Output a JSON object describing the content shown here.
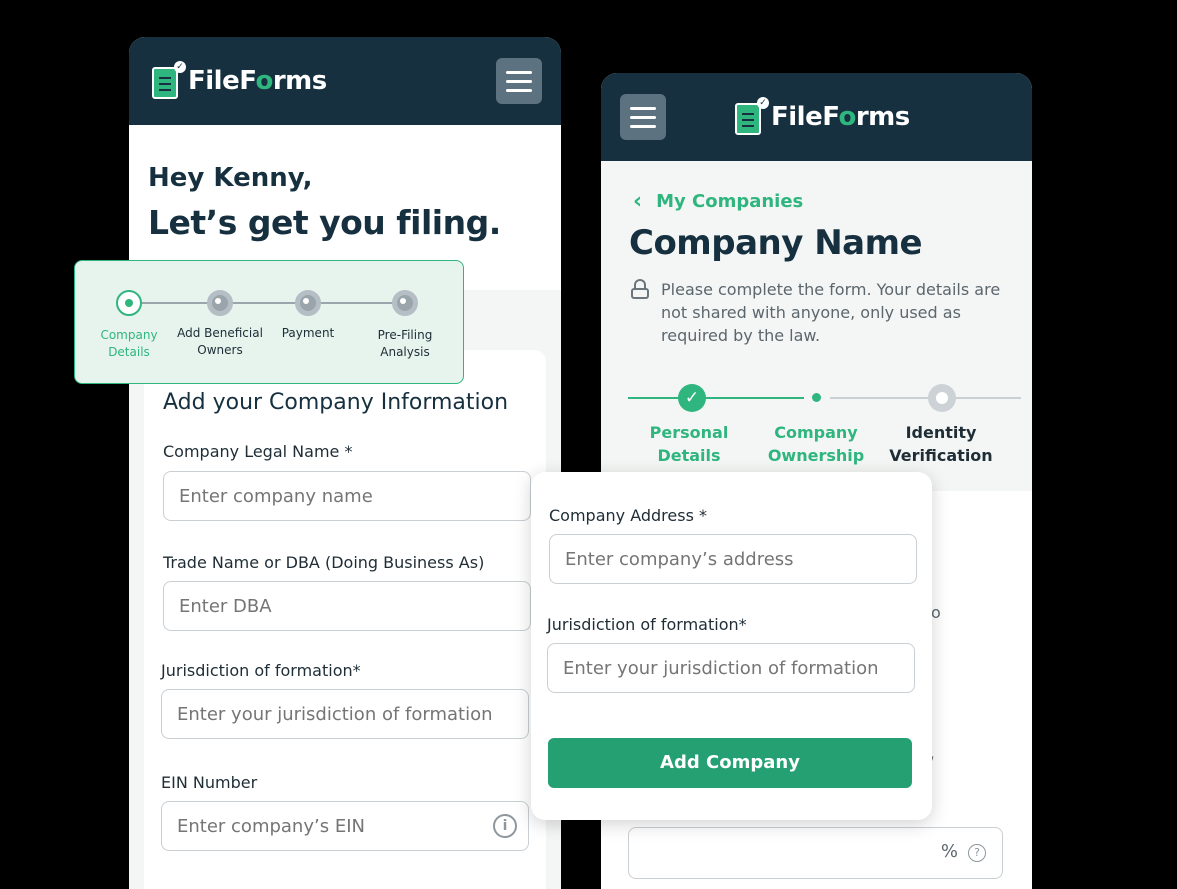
{
  "brand": {
    "name_prefix": "FileF",
    "name_o": "o",
    "name_suffix": "rms",
    "accent": "#2fb57e",
    "dark": "#16303f"
  },
  "left_screen": {
    "greeting": "Hey Kenny,",
    "headline": "Let’s get you filing.",
    "steps": [
      {
        "label_line1": "Company",
        "label_line2": "Details",
        "state": "active"
      },
      {
        "label_line1": "Add Beneficial",
        "label_line2": "Owners",
        "state": "inactive"
      },
      {
        "label_line1": "Payment",
        "label_line2": "",
        "state": "inactive"
      },
      {
        "label_line1": "Pre-Filing",
        "label_line2": "Analysis",
        "state": "inactive"
      }
    ],
    "form_title": "Add your Company Information",
    "fields": [
      {
        "label": "Company Legal Name *",
        "placeholder": "Enter company name"
      },
      {
        "label": "Trade Name or DBA (Doing Business As)",
        "placeholder": "Enter DBA"
      },
      {
        "label": "Jurisdiction of formation*",
        "placeholder": "Enter your jurisdiction of formation"
      },
      {
        "label": "EIN Number",
        "placeholder": "Enter company’s EIN",
        "icon": "info-icon"
      }
    ]
  },
  "right_screen": {
    "back_label": "My Companies",
    "title": "Company Name",
    "notice": "Please complete the form. Your details are not shared with anyone, only used as required by the law.",
    "steps": [
      {
        "label_line1": "Personal",
        "label_line2": "Details",
        "state": "done"
      },
      {
        "label_line1": "Company",
        "label_line2": "Ownership",
        "state": "current"
      },
      {
        "label_line1": "Identity",
        "label_line2": "Verification",
        "state": "pending"
      }
    ],
    "fragment_o": "o",
    "fragment_y": "/",
    "percent_sign": "%",
    "help_glyph": "?"
  },
  "popup_card": {
    "fields": [
      {
        "label": "Company Address *",
        "placeholder": "Enter company’s address"
      },
      {
        "label": "Jurisdiction of formation*",
        "placeholder": "Enter your jurisdiction of formation"
      }
    ],
    "button_label": "Add Company"
  }
}
